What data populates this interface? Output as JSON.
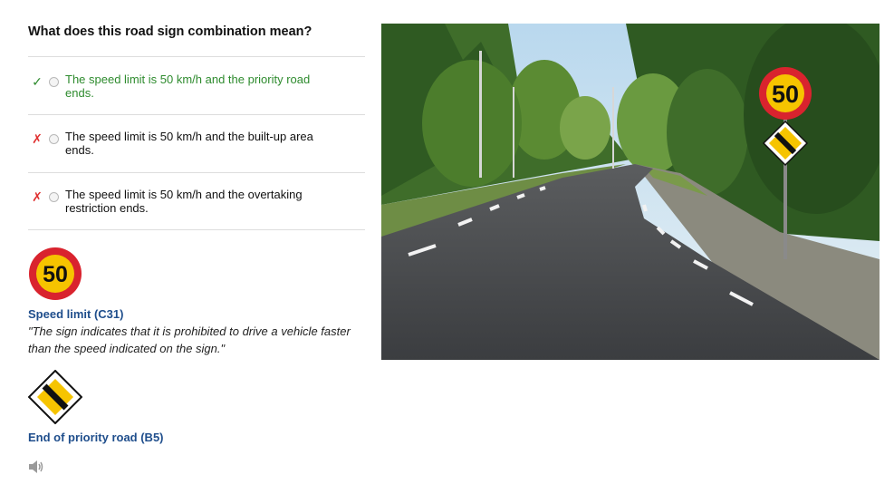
{
  "question": "What does this road sign combination mean?",
  "options": [
    {
      "label": "The speed limit is 50 km/h and the priority road ends.",
      "mark": "✓",
      "status": "correct"
    },
    {
      "label": "The speed limit is 50 km/h and the built-up area ends.",
      "mark": "✗",
      "status": "incorrect"
    },
    {
      "label": "The speed limit is 50 km/h and the overtaking restriction ends.",
      "mark": "✗",
      "status": "incorrect"
    }
  ],
  "signs": [
    {
      "value": "50",
      "title": "Speed limit (C31)",
      "description": "\"The sign indicates that it is prohibited to drive a vehicle faster than the speed indicated on the sign.\""
    },
    {
      "title": "End of priority road (B5)"
    }
  ],
  "photo": {
    "sign_value": "50"
  },
  "icons": {
    "speaker": "speaker-icon"
  },
  "colors": {
    "correct": "#2e8b2e",
    "incorrect": "#e03030",
    "link_blue": "#1f4e8c",
    "sign_red": "#d9232e",
    "sign_yellow": "#f6c400"
  }
}
